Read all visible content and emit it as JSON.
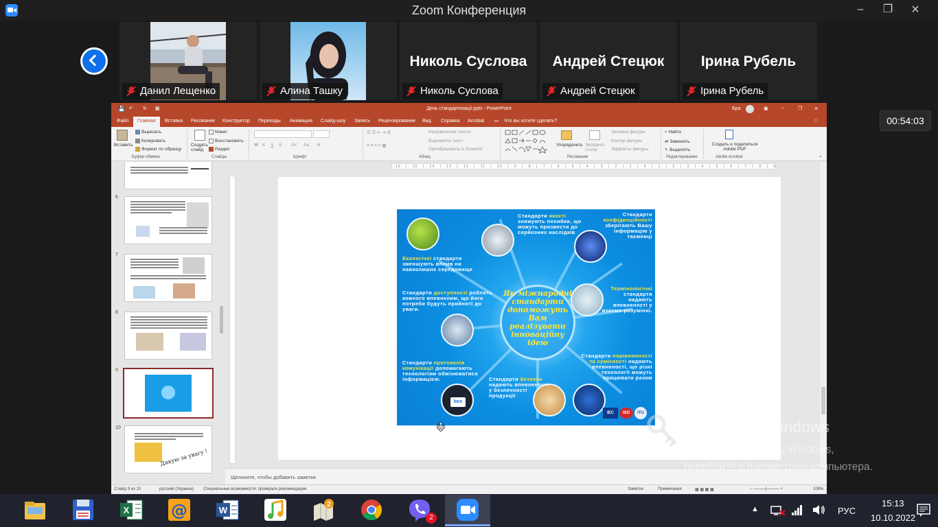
{
  "zoom": {
    "title": "Zoom Конференция",
    "timer": "00:54:03",
    "participants": [
      {
        "name": "Данил Лещенко",
        "has_video": true
      },
      {
        "name": "Алина Ташку",
        "has_video": true
      },
      {
        "name": "Николь Суслова",
        "has_video": false
      },
      {
        "name": "Андрей Стецюк",
        "has_video": false
      },
      {
        "name": "Ірина Рубель",
        "has_video": false
      }
    ]
  },
  "ppt": {
    "file_title": "День стандартизації.pptx - PowerPoint",
    "user": "Бра",
    "tabs": [
      "Файл",
      "Главная",
      "Вставка",
      "Рисование",
      "Конструктор",
      "Переходы",
      "Анимация",
      "Слайд-шоу",
      "Запись",
      "Рецензирование",
      "Вид",
      "Справка",
      "Acrobat"
    ],
    "tell_me": "Что вы хотите сделать?",
    "ribbon": {
      "paste": "Вставить",
      "cut": "Вырезать",
      "copy": "Копировать",
      "format_painter": "Формат по образцу",
      "clipboard_group": "Буфер обмена",
      "new_slide": "Создать слайд",
      "layout": "Макет",
      "reset": "Восстановить",
      "section": "Раздел",
      "slides_group": "Слайды",
      "font_group": "Шрифт",
      "text_direction": "Направление текста",
      "align_text": "Выровнять текст",
      "smartart": "Преобразовать в SmartArt",
      "paragraph_group": "Абзац",
      "arrange": "Упорядочить",
      "quick_styles": "Экспресс-стили",
      "shape_fill": "Заливка фигуры",
      "shape_outline": "Контур фигуры",
      "shape_effects": "Эффекты фигуры",
      "drawing_group": "Рисование",
      "find": "Найти",
      "replace": "Заменить",
      "select": "Выделить",
      "editing_group": "Редактирование",
      "acrobat_create": "Создать и поделиться Adobe PDF",
      "acrobat_group": "Adobe Acrobat"
    },
    "thumbnails": [
      {
        "num": "6"
      },
      {
        "num": "7"
      },
      {
        "num": "8"
      },
      {
        "num": "9",
        "selected": true
      },
      {
        "num": "10",
        "text": "Дякую за увагу !"
      }
    ],
    "notes_placeholder": "Щелкните, чтобы добавить заметки",
    "status": {
      "slide": "Слайд 9 из 10",
      "language": "русский (Украина)",
      "accessibility": "Специальные возможности: проверьте рекомендации",
      "notes": "Заметки",
      "comments": "Примечания",
      "zoom": "108%"
    },
    "ruler_h": "· 16 · | · 15 · | · 14 · | · 13 · | · 12 · | · 11 · | · 10 · | · 9 · | · 8 · | · 7 · | · 6 · | · 5 · | · 4 · | · 3 · | · 2 · | · 1 · | · 0 · | · 1 · | · 2 · | · 3 · | · 4 · | · 5 · | · 6 · | · 7 · | · 8 · | · 9 · | · 10 · | · 11 · | · 12 · | · 13 · | · 14 · | · 15 · | · 16 ·"
  },
  "infographic": {
    "center": "Як міжнародні стандарти допоможуть Вам реалізувати інноваційну ідею",
    "items": [
      {
        "pre": "Стандарти ",
        "hl": "якості",
        "post": " знижують похибки, що можуть призвести до серйозних наслідків"
      },
      {
        "pre": "Стандарти ",
        "hl": "конфіденційності",
        "post": " зберігають Вашу інформацію у таємниці"
      },
      {
        "pre": "",
        "hl": "Екологічні",
        "post": " стандарти зменшують вплив на навколишнє середовище"
      },
      {
        "pre": "",
        "hl": "Термінологічні",
        "post": " стандарти надають впевненості у взаємо-розумінні."
      },
      {
        "pre": "Стандарти ",
        "hl": "доступності",
        "post": " роблять кожного впевненим, що його потреби будуть прийняті до уваги."
      },
      {
        "pre": "Стандарти ",
        "hl": "порівнянності та сумісності",
        "post": " надають впевненості, що різні технології можуть працювати разом"
      },
      {
        "pre": "Стандарти ",
        "hl": "протоколів комунікації",
        "post": " допомагають технологіям обмінюватися інформацією."
      },
      {
        "pre": "Стандарти ",
        "hl": "безпеки",
        "post": " надають впевненості у безпечності продукції"
      }
    ],
    "logos": [
      "IEC",
      "ISO",
      "ITU"
    ],
    "box_label": "box"
  },
  "windows": {
    "activation_title": "Активация Windows",
    "activation_line1": "Чтобы активировать Windows,",
    "activation_line2": "перейдите к параметрам компьютера.",
    "language": "РУС",
    "time": "15:13",
    "date": "10.10.2022",
    "viber_badge": "2"
  },
  "colors": {
    "ppt_accent": "#b7472a",
    "zoom_blue": "#0e71eb",
    "infographic_blue": "#0b8de0",
    "highlight_yellow": "#ffe63a"
  }
}
